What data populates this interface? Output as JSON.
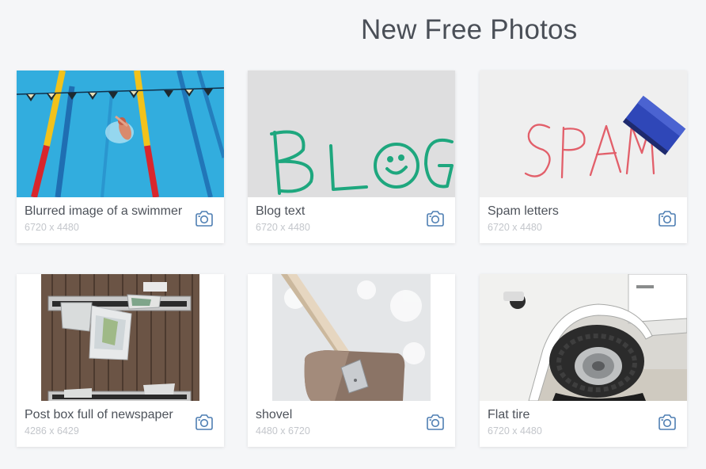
{
  "page": {
    "title": "New Free Photos"
  },
  "photos": [
    {
      "title": "Blurred image of a swimmer",
      "size": "6720 x 4480",
      "icon": "camera-icon"
    },
    {
      "title": "Blog text",
      "size": "6720 x 4480",
      "icon": "camera-icon"
    },
    {
      "title": "Spam letters",
      "size": "6720 x 4480",
      "icon": "camera-icon"
    },
    {
      "title": "Post box full of newspaper",
      "size": "4286 x 6429",
      "icon": "camera-icon"
    },
    {
      "title": "shovel",
      "size": "4480 x 6720",
      "icon": "camera-icon"
    },
    {
      "title": "Flat tire",
      "size": "6720 x 4480",
      "icon": "camera-icon"
    }
  ],
  "colors": {
    "background": "#f5f6f8",
    "card": "#ffffff",
    "accent_icon": "#4f7fb3",
    "title_text": "#4a4f57",
    "meta_text": "#c3c6cb"
  }
}
